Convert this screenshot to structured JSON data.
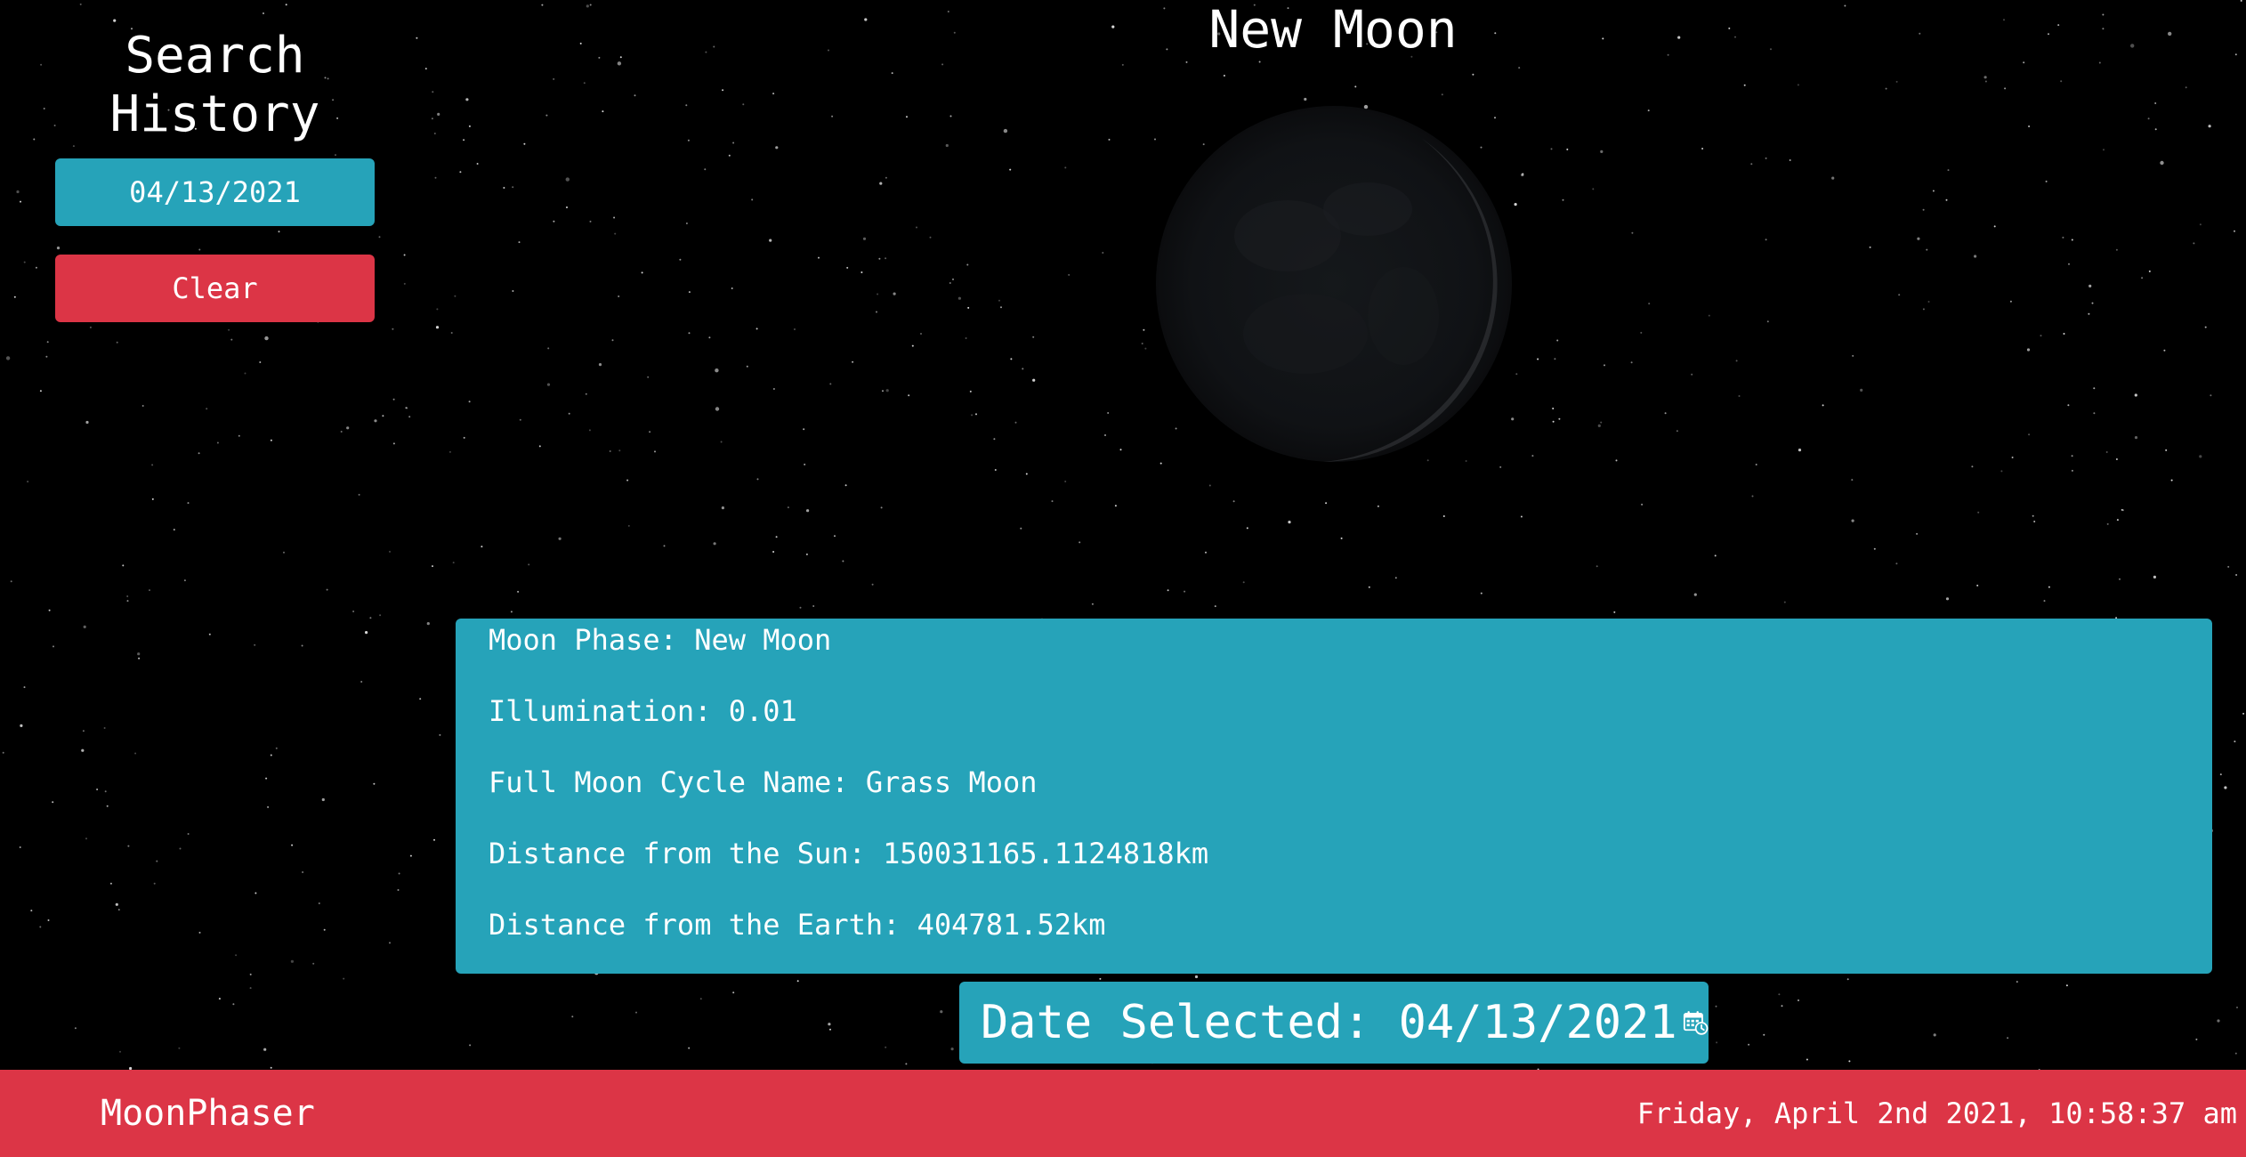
{
  "sidebar": {
    "title": "Search\nHistory",
    "title_line1": "Search",
    "title_line2": "History",
    "history_items": [
      "04/13/2021"
    ],
    "clear_label": "Clear"
  },
  "main": {
    "phase_title": "New Moon",
    "moon_image": "moon-phase-image",
    "info": [
      {
        "label": "Moon Phase:",
        "value": "New Moon"
      },
      {
        "label": "Illumination:",
        "value": "0.01"
      },
      {
        "label": "Full Moon Cycle Name:",
        "value": "Grass Moon"
      },
      {
        "label": "Distance from the Sun:",
        "value": "150031165.1124818km"
      },
      {
        "label": "Distance from the Earth:",
        "value": "404781.52km"
      }
    ],
    "date_selected_label": "Date Selected:",
    "date_selected_value": "04/13/2021",
    "date_icon": "calendar-clock-icon"
  },
  "footer": {
    "brand": "MoonPhaser",
    "datetime": "Friday, April 2nd 2021, 10:58:37 am"
  },
  "colors": {
    "background": "#000000",
    "teal": "#26a3b9",
    "red": "#dc3546",
    "text": "#ffffff"
  }
}
